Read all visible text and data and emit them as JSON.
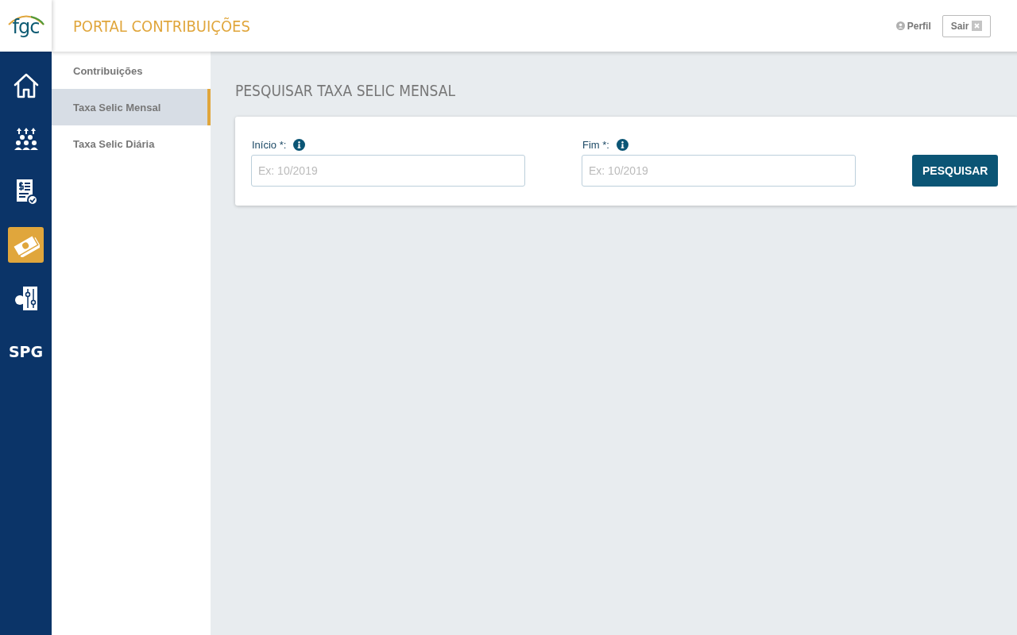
{
  "logo": {
    "text": "fgc"
  },
  "header": {
    "title": "PORTAL CONTRIBUIÇÕES",
    "profile": "Perfil",
    "logout": "Sair"
  },
  "rail": [
    {
      "kind": "home",
      "selected": false
    },
    {
      "kind": "people",
      "selected": false
    },
    {
      "kind": "document",
      "selected": false
    },
    {
      "kind": "money",
      "selected": true
    },
    {
      "kind": "settings",
      "selected": false
    },
    {
      "kind": "text",
      "label": "SPG",
      "selected": false
    }
  ],
  "submenu": [
    {
      "label": "Contribuições",
      "selected": false
    },
    {
      "label": "Taxa Selic Mensal",
      "selected": true
    },
    {
      "label": "Taxa Selic Diária",
      "selected": false
    }
  ],
  "page_title": "PESQUISAR TAXA SELIC MENSAL",
  "form": {
    "fields": [
      {
        "label": "Início *:",
        "placeholder": "Ex: 10/2019"
      },
      {
        "label": "Fim *:",
        "placeholder": "Ex: 10/2019"
      }
    ],
    "button": "PESQUISAR"
  }
}
